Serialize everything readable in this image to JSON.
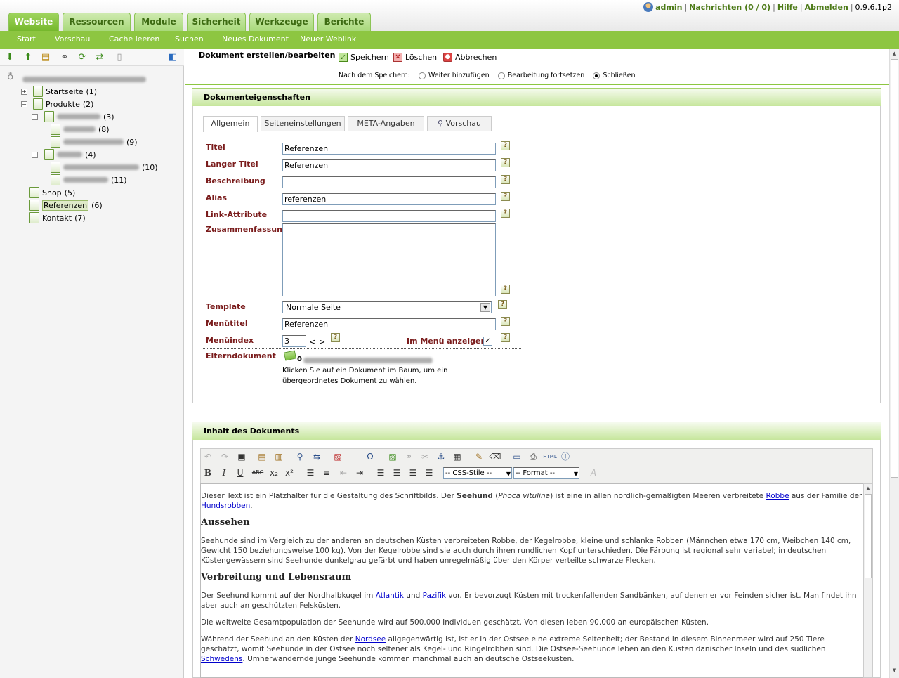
{
  "header": {
    "tabs": [
      "Website",
      "Ressourcen",
      "Module",
      "Sicherheit",
      "Werkzeuge",
      "Berichte"
    ],
    "user": "admin",
    "messages_label": "Nachrichten",
    "messages_count": "(0 / 0)",
    "help": "Hilfe",
    "logout": "Abmelden",
    "version": "0.9.6.1p2"
  },
  "subnav": [
    "Start",
    "Vorschau",
    "Cache leeren",
    "Suchen",
    "Neues Dokument",
    "Neuer Weblink"
  ],
  "tree": {
    "nodes": [
      {
        "label": "Startseite",
        "count": "(1)"
      },
      {
        "label": "Produkte",
        "count": "(2)"
      },
      {
        "label": "",
        "count": "(3)"
      },
      {
        "label": "",
        "count": "(8)"
      },
      {
        "label": "",
        "count": "(9)"
      },
      {
        "label": "",
        "count": "(4)"
      },
      {
        "label": "",
        "count": "(10)"
      },
      {
        "label": "",
        "count": "(11)"
      },
      {
        "label": "Shop",
        "count": "(5)"
      },
      {
        "label": "Referenzen",
        "count": "(6)"
      },
      {
        "label": "Kontakt",
        "count": "(7)"
      }
    ]
  },
  "actions": {
    "title": "Dokument erstellen/bearbeiten",
    "save": "Speichern",
    "delete": "Löschen",
    "cancel": "Abbrechen",
    "after_save_label": "Nach dem Speichern:",
    "opt_add": "Weiter hinzufügen",
    "opt_continue": "Bearbeitung fortsetzen",
    "opt_close": "Schließen"
  },
  "props": {
    "heading": "Dokumenteigenschaften",
    "tabs": [
      "Allgemein",
      "Seiteneinstellungen",
      "META-Angaben",
      "Vorschau"
    ],
    "title_label": "Titel",
    "title_value": "Referenzen",
    "longtitle_label": "Langer Titel",
    "longtitle_value": "Referenzen",
    "desc_label": "Beschreibung",
    "desc_value": "",
    "alias_label": "Alias",
    "alias_value": "referenzen",
    "linkattr_label": "Link-Attribute",
    "linkattr_value": "",
    "summary_label": "Zusammenfassung",
    "template_label": "Template",
    "template_value": "Normale Seite",
    "menutitle_label": "Menütitel",
    "menutitle_value": "Referenzen",
    "menuindex_label": "Menüindex",
    "menuindex_value": "3",
    "menuindex_prev": "<",
    "menuindex_next": ">",
    "showmenu_label": "Im Menü anzeigen",
    "parent_label": "Elterndokument",
    "parent_value": "0",
    "parent_hint1": "Klicken Sie auf ein Dokument im Baum, um ein",
    "parent_hint2": "übergeordnetes Dokument zu wählen."
  },
  "content": {
    "heading": "Inhalt des Dokuments",
    "css_select": "-- CSS-Stile --",
    "format_select": "-- Format --",
    "p1_a": "Dieser Text ist ein Platzhalter für die Gestaltung des Schriftbilds. Der ",
    "p1_bold": "Seehund",
    "p1_b": " (",
    "p1_italic": "Phoca vitulina",
    "p1_c": ") ist eine in allen nördlich-gemäßigten Meeren verbreitete ",
    "p1_link1": "Robbe",
    "p1_d": " aus der Familie der ",
    "p1_link2": "Hundsrobben",
    "p1_e": ".",
    "h1": "Aussehen",
    "p2": "Seehunde sind im Vergleich zu der anderen an deutschen Küsten verbreiteten Robbe, der Kegelrobbe, kleine und schlanke Robben (Männchen etwa 170 cm, Weibchen 140 cm, Gewicht 150 beziehungsweise 100 kg). Von der Kegelrobbe sind sie auch durch ihren rundlichen Kopf unterschieden. Die Färbung ist regional sehr variabel; in deutschen Küstengewässern sind Seehunde dunkelgrau gefärbt und haben unregelmäßig über den Körper verteilte schwarze Flecken.",
    "h2": "Verbreitung und Lebensraum",
    "p3_a": "Der Seehund kommt auf der Nordhalbkugel im ",
    "p3_link1": "Atlantik",
    "p3_b": " und ",
    "p3_link2": "Pazifik",
    "p3_c": " vor. Er bevorzugt Küsten mit trockenfallenden Sandbänken, auf denen er vor Feinden sicher ist. Man findet ihn aber auch an geschützten Felsküsten.",
    "p4": "Die weltweite Gesamtpopulation der Seehunde wird auf 500.000 Individuen geschätzt. Von diesen leben 90.000 an europäischen Küsten.",
    "p5_a": "Während der Seehund an den Küsten der ",
    "p5_link1": "Nordsee",
    "p5_b": " allgegenwärtig ist, ist er in der Ostsee eine extreme Seltenheit; der Bestand in diesem Binnenmeer wird auf 250 Tiere geschätzt, womit Seehunde in der Ostsee noch seltener als Kegel- und Ringelrobben sind. Die Ostsee-Seehunde leben an den Küsten dänischer Inseln und des südlichen ",
    "p5_link2": "Schwedens",
    "p5_c": ". Umherwandernde junge Seehunde kommen manchmal auch an deutsche Ostseeküsten."
  }
}
